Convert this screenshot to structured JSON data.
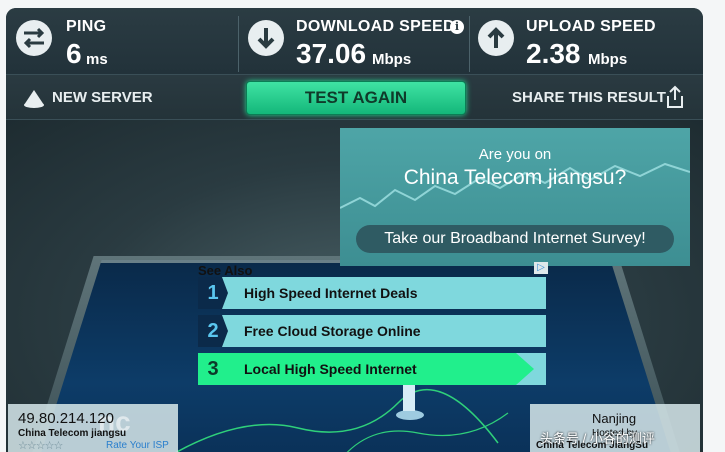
{
  "metrics": {
    "ping": {
      "label": "PING",
      "value": "6",
      "unit": "ms"
    },
    "download": {
      "label": "DOWNLOAD SPEED",
      "value": "37.06",
      "unit": "Mbps",
      "info": "i"
    },
    "upload": {
      "label": "UPLOAD SPEED",
      "value": "2.38",
      "unit": "Mbps"
    }
  },
  "actions": {
    "new_server": "NEW SERVER",
    "test_again": "TEST AGAIN",
    "share": "SHARE THIS RESULT"
  },
  "ad": {
    "line1": "Are you on",
    "line2": "China Telecom jiangsu?",
    "button": "Take our Broadband Internet Survey!",
    "adchoices": "▷"
  },
  "see_also": {
    "title": "See Also",
    "items": [
      {
        "num": "1",
        "label": "High Speed Internet Deals"
      },
      {
        "num": "2",
        "label": "Free Cloud Storage Online"
      },
      {
        "num": "3",
        "label": "Local High Speed Internet"
      }
    ]
  },
  "isp": {
    "ip": "49.80.214.120",
    "name": "China Telecom jiangsu",
    "stars": "☆☆☆☆☆",
    "rate": "Rate Your ISP",
    "watermark": "nc"
  },
  "server": {
    "city": "Nanjing",
    "hosted": "Hosted by",
    "host": "China Telecom JiangSu"
  },
  "overlay_watermark": "头条号 / 小谷的测评",
  "colors": {
    "accent": "#21ef8c",
    "panel": "#2a3b41"
  }
}
